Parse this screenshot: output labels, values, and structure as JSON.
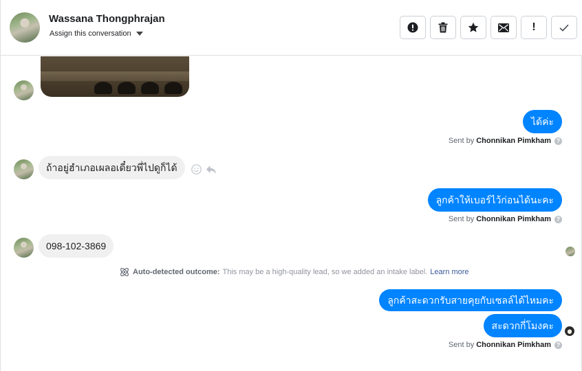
{
  "header": {
    "contact_name": "Wassana Thongphrajan",
    "assign_label": "Assign this conversation",
    "actions": [
      {
        "name": "spam-button",
        "icon": "alert-circle-icon"
      },
      {
        "name": "delete-button",
        "icon": "trash-icon"
      },
      {
        "name": "star-button",
        "icon": "star-icon"
      },
      {
        "name": "mark-unread-button",
        "icon": "envelope-icon"
      },
      {
        "name": "follow-up-button",
        "icon": "exclamation-icon"
      },
      {
        "name": "mark-done-button",
        "icon": "checkmark-icon"
      }
    ]
  },
  "messages": [
    {
      "id": "m1",
      "dir": "out",
      "text": "ได้ค่ะ",
      "sent_by_prefix": "Sent by",
      "sent_by": "Chonnikan Pimkham"
    },
    {
      "id": "m2",
      "dir": "in",
      "text": "ถ้าอยู่ฮำเภอเผลอเดี๋ยวพี่ไปดูก็ได้"
    },
    {
      "id": "m3",
      "dir": "out",
      "text": "ลูกค้าให้เบอร์ไว้ก่อนได้นะคะ",
      "sent_by_prefix": "Sent by",
      "sent_by": "Chonnikan Pimkham"
    },
    {
      "id": "m4",
      "dir": "in",
      "text": "098-102-3869"
    },
    {
      "id": "m5",
      "dir": "out",
      "text": "ลูกค้าสะดวกรับสายคุยกับเซลล์ได้ไหมคะ"
    },
    {
      "id": "m6",
      "dir": "out",
      "text": "สะดวกกี่โมงคะ",
      "sent_by_prefix": "Sent by",
      "sent_by": "Chonnikan Pimkham"
    }
  ],
  "auto_detect": {
    "label": "Auto-detected outcome:",
    "text": "This may be a high-quality lead, so we added an intake label.",
    "link": "Learn more"
  },
  "colors": {
    "outgoing_bubble": "#0084ff",
    "incoming_bubble": "#f1f0f0",
    "link": "#385898"
  }
}
